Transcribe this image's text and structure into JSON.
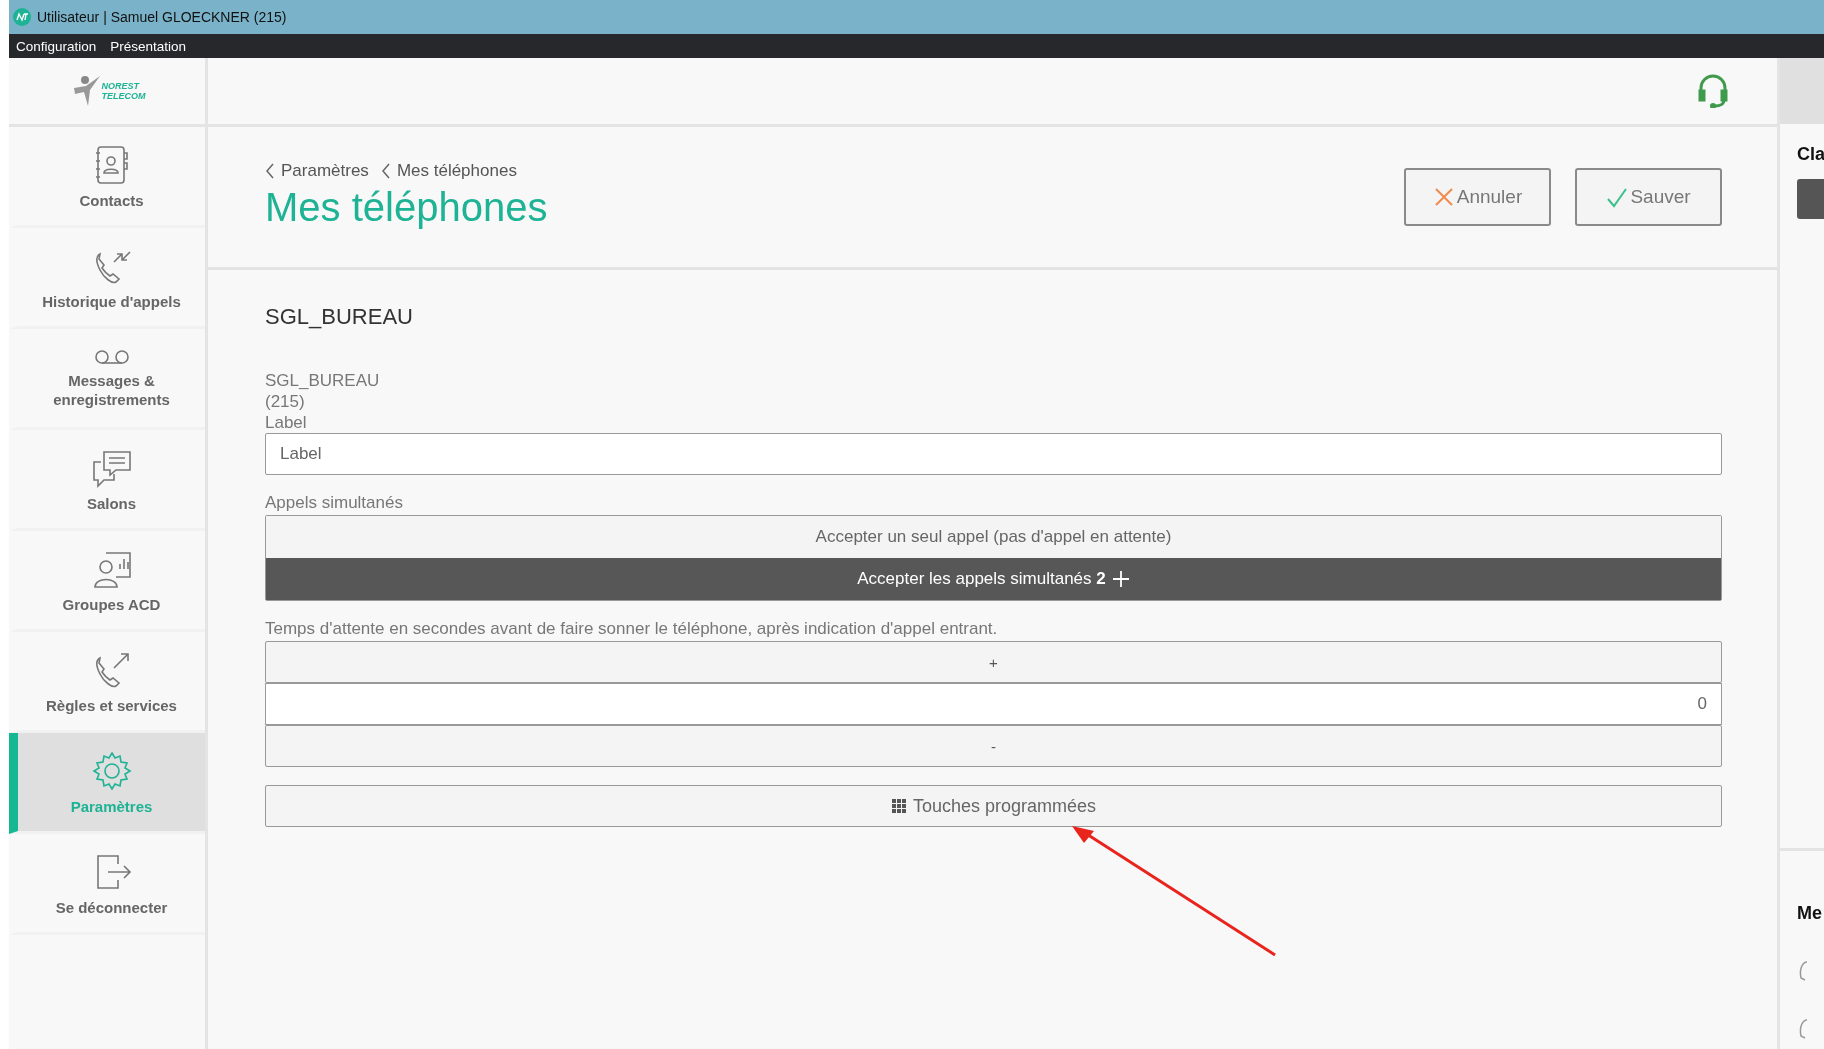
{
  "window": {
    "title": "Utilisateur | Samuel GLOECKNER (215)"
  },
  "menu": [
    {
      "label": "Configuration"
    },
    {
      "label": "Présentation"
    }
  ],
  "logo": {
    "lines": [
      "NOREST",
      "TELECOM"
    ]
  },
  "sidebar": {
    "items": [
      {
        "kind": "contacts",
        "label": "Contacts",
        "selected": false
      },
      {
        "kind": "history",
        "label": "Historique d'appels",
        "selected": false
      },
      {
        "kind": "voicemail",
        "label": "Messages & enregistrements",
        "selected": false
      },
      {
        "kind": "rooms",
        "label": "Salons",
        "selected": false
      },
      {
        "kind": "acd",
        "label": "Groupes ACD",
        "selected": false
      },
      {
        "kind": "rules",
        "label": "Règles et services",
        "selected": false
      },
      {
        "kind": "settings",
        "label": "Paramètres",
        "selected": true
      },
      {
        "kind": "logout",
        "label": "Se déconnecter",
        "selected": false
      }
    ]
  },
  "breadcrumb": [
    "Paramètres",
    "Mes téléphones"
  ],
  "page_title": "Mes téléphones",
  "actions": [
    {
      "kind": "cancel",
      "label": "Annuler"
    },
    {
      "kind": "save",
      "label": "Sauver"
    }
  ],
  "phone": {
    "heading": "SGL_BUREAU",
    "name": "SGL_BUREAU",
    "number": "(215)",
    "label_caption": "Label",
    "label_field": {
      "placeholder": "Label"
    }
  },
  "simultaneous": {
    "caption": "Appels simultanés",
    "options": [
      {
        "label": "Accepter un seul appel (pas d'appel en attente)",
        "selected": false
      },
      {
        "label": "Accepter les appels simultanés **2**",
        "selected": true
      }
    ]
  },
  "delay": {
    "caption": "Temps d'attente en secondes avant de faire sonner le téléphone, après indication d'appel entrant.",
    "increment": "+",
    "value": "0",
    "decrement": "-"
  },
  "programmed_keys": {
    "label": "Touches programmées"
  },
  "right_panel": {
    "headings": [
      "Cla",
      "Me"
    ]
  }
}
